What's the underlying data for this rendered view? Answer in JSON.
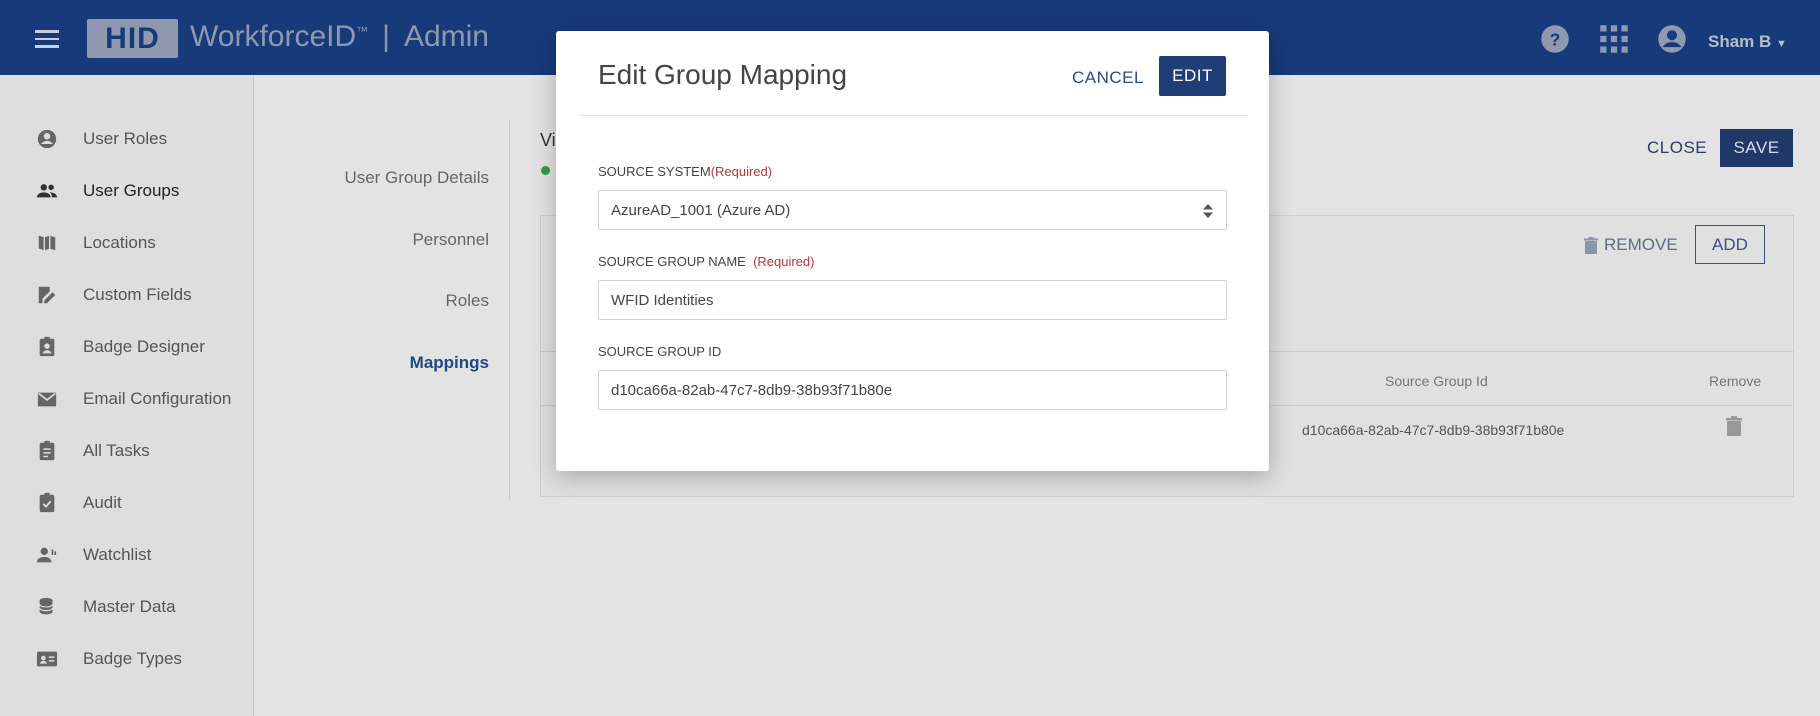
{
  "header": {
    "logo_text": "HID",
    "product": "WorkforceID",
    "tm": "™",
    "separator": "|",
    "section": "Admin",
    "user_name": "Sham B",
    "icons": [
      "help-icon",
      "apps-grid-icon",
      "account-circle-icon"
    ]
  },
  "sidebar": {
    "items": [
      {
        "label": "User Roles",
        "icon": "user-circle-icon"
      },
      {
        "label": "User Groups",
        "icon": "people-icon",
        "active": true
      },
      {
        "label": "Locations",
        "icon": "map-icon"
      },
      {
        "label": "Custom Fields",
        "icon": "edit-doc-icon"
      },
      {
        "label": "Badge Designer",
        "icon": "badge-icon"
      },
      {
        "label": "Email Configuration",
        "icon": "mail-icon"
      },
      {
        "label": "All Tasks",
        "icon": "clipboard-icon"
      },
      {
        "label": "Audit",
        "icon": "clipboard-check-icon"
      },
      {
        "label": "Watchlist",
        "icon": "person-watch-icon"
      },
      {
        "label": "Master Data",
        "icon": "database-icon"
      },
      {
        "label": "Badge Types",
        "icon": "id-card-icon"
      }
    ]
  },
  "main": {
    "tabs": [
      {
        "label": "User Group Details"
      },
      {
        "label": "Personnel"
      },
      {
        "label": "Roles"
      },
      {
        "label": "Mappings",
        "active": true
      }
    ],
    "title_partial": "Vi",
    "close_label": "CLOSE",
    "save_label": "SAVE",
    "remove_label": "REMOVE",
    "add_label": "ADD",
    "table": {
      "headers": [
        "Source Group Id",
        "Remove"
      ],
      "rows": [
        [
          "d10ca66a-82ab-47c7-8db9-38b93f71b80e"
        ]
      ]
    }
  },
  "modal": {
    "title": "Edit Group Mapping",
    "cancel_label": "CANCEL",
    "edit_label": "EDIT",
    "fields": {
      "source_system": {
        "label": "SOURCE SYSTEM",
        "required": "(Required)",
        "value": "AzureAD_1001 (Azure AD)"
      },
      "source_group_name": {
        "label": "SOURCE GROUP NAME",
        "required": "(Required)",
        "value": "WFID Identities"
      },
      "source_group_id": {
        "label": "SOURCE GROUP ID",
        "value": "d10ca66a-82ab-47c7-8db9-38b93f71b80e"
      }
    }
  },
  "colors": {
    "header_bg": "#173a7a",
    "primary": "#1f3d77",
    "required": "#b03a3a",
    "status_green": "#2e9e45"
  }
}
